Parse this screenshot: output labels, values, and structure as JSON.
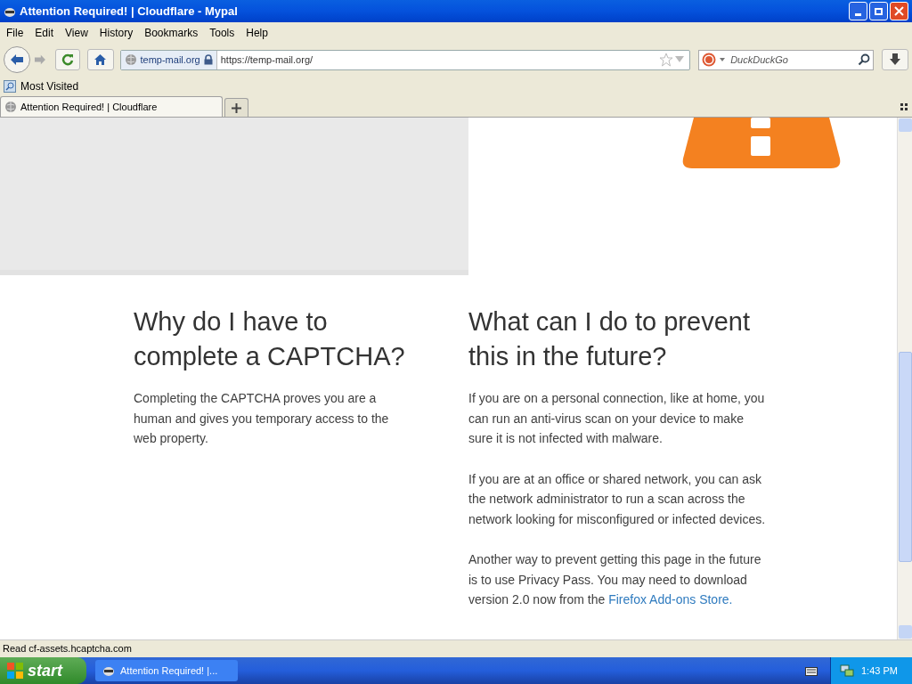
{
  "window": {
    "title": "Attention Required! | Cloudflare - Mypal"
  },
  "menu": [
    "File",
    "Edit",
    "View",
    "History",
    "Bookmarks",
    "Tools",
    "Help"
  ],
  "address": {
    "site": "temp-mail.org",
    "url": "https://temp-mail.org/"
  },
  "search": {
    "placeholder": "DuckDuckGo"
  },
  "bookmarks": [
    "Most Visited"
  ],
  "tabs": [
    {
      "label": "Attention Required! | Cloudflare",
      "selected": true
    }
  ],
  "page": {
    "columns": [
      {
        "heading": "Why do I have to complete a CAPTCHA?",
        "paragraphs": [
          {
            "text": "Completing the CAPTCHA proves you are a human and gives you temporary access to the web property."
          }
        ]
      },
      {
        "heading": "What can I do to prevent this in the future?",
        "paragraphs": [
          {
            "text": "If you are on a personal connection, like at home, you can run an anti-virus scan on your device to make sure it is not infected with malware."
          },
          {
            "text": "If you are at an office or shared network, you can ask the network administrator to run a scan across the network looking for misconfigured or infected devices."
          },
          {
            "text": "Another way to prevent getting this page in the future is to use Privacy Pass. You may need to download version 2.0 now from the",
            "link": "Firefox Add-ons Store."
          }
        ]
      }
    ]
  },
  "status_bar": "Read cf-assets.hcaptcha.com",
  "taskbar": {
    "start": "start",
    "tasks": [
      {
        "label": "Attention Required! |...",
        "selected": false
      }
    ],
    "clock": "1:43 PM"
  }
}
